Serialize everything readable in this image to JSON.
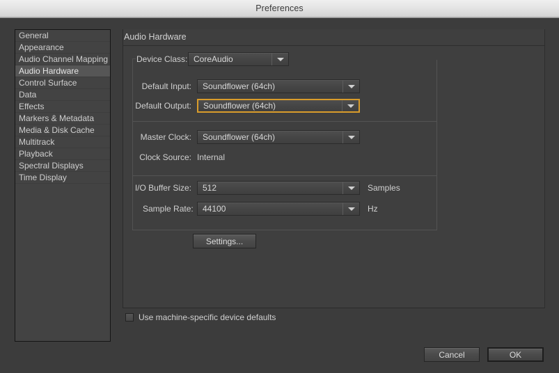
{
  "window": {
    "title": "Preferences"
  },
  "sidebar": {
    "items": [
      {
        "label": "General",
        "selected": false
      },
      {
        "label": "Appearance",
        "selected": false
      },
      {
        "label": "Audio Channel Mapping",
        "selected": false
      },
      {
        "label": "Audio Hardware",
        "selected": true
      },
      {
        "label": "Control Surface",
        "selected": false
      },
      {
        "label": "Data",
        "selected": false
      },
      {
        "label": "Effects",
        "selected": false
      },
      {
        "label": "Markers & Metadata",
        "selected": false
      },
      {
        "label": "Media & Disk Cache",
        "selected": false
      },
      {
        "label": "Multitrack",
        "selected": false
      },
      {
        "label": "Playback",
        "selected": false
      },
      {
        "label": "Spectral Displays",
        "selected": false
      },
      {
        "label": "Time Display",
        "selected": false
      }
    ]
  },
  "panel": {
    "title": "Audio Hardware",
    "device_class": {
      "label": "Device Class:",
      "value": "CoreAudio",
      "icon": "chevron-down-icon"
    },
    "default_input": {
      "label": "Default Input:",
      "value": "Soundflower (64ch)",
      "icon": "chevron-down-icon"
    },
    "default_output": {
      "label": "Default Output:",
      "value": "Soundflower (64ch)",
      "icon": "chevron-down-icon",
      "focused": true
    },
    "master_clock": {
      "label": "Master Clock:",
      "value": "Soundflower (64ch)",
      "icon": "chevron-down-icon"
    },
    "clock_source": {
      "label": "Clock Source:",
      "value": "Internal"
    },
    "io_buffer_size": {
      "label": "I/O Buffer Size:",
      "value": "512",
      "unit": "Samples",
      "icon": "chevron-down-icon"
    },
    "sample_rate": {
      "label": "Sample Rate:",
      "value": "44100",
      "unit": "Hz",
      "icon": "chevron-down-icon"
    },
    "settings_button": "Settings...",
    "machine_defaults": {
      "label": "Use machine-specific device defaults",
      "checked": false
    }
  },
  "footer": {
    "cancel_label": "Cancel",
    "ok_label": "OK"
  },
  "colors": {
    "focus_ring": "#d99c2b",
    "window_background": "#3c3c3c",
    "panel_background": "#3f3f3f",
    "selection": "#565656",
    "titlebar": "#e4e4e4"
  }
}
